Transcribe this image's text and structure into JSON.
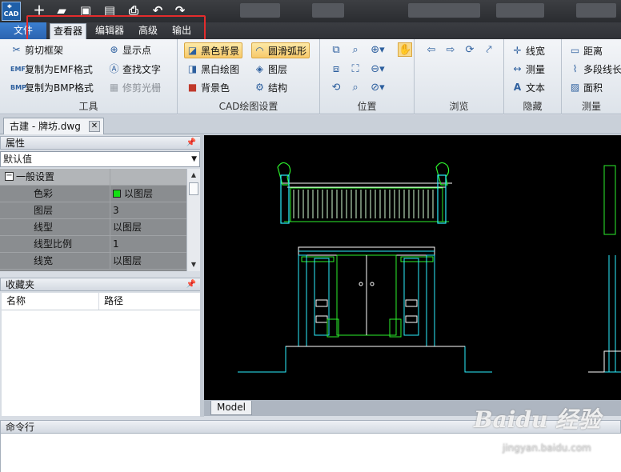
{
  "app": {
    "logo_text": "CAD"
  },
  "quick_access": [
    "new-icon",
    "open-icon",
    "save-icon",
    "save-as-icon",
    "print-icon",
    "undo-icon",
    "redo-icon"
  ],
  "ribbon_tabs": {
    "file": "文件",
    "tabs": [
      {
        "label": "查看器",
        "active": true
      },
      {
        "label": "编辑器",
        "active": false
      },
      {
        "label": "高级",
        "active": false
      },
      {
        "label": "输出",
        "active": false
      }
    ]
  },
  "ribbon": {
    "tools": {
      "label": "工具",
      "buttons": [
        "剪切框架",
        "复制为EMF格式",
        "复制为BMP格式",
        "显示点",
        "查找文字",
        "修剪光栅"
      ]
    },
    "cad_settings": {
      "label": "CAD绘图设置",
      "buttons": [
        "黑色背景",
        "黑白绘图",
        "背景色",
        "圆滑弧形",
        "图层",
        "结构"
      ]
    },
    "position": {
      "label": "位置"
    },
    "browse": {
      "label": "浏览"
    },
    "hide": {
      "label": "隐藏",
      "buttons": [
        "线宽",
        "测量",
        "文本"
      ]
    },
    "measure": {
      "label": "测量",
      "buttons": [
        "距离",
        "多段线长",
        "面积"
      ]
    }
  },
  "document": {
    "tab_label": "古建 - 牌坊.dwg"
  },
  "properties": {
    "title": "属性",
    "selector_value": "默认值",
    "category": "一般设置",
    "rows": [
      {
        "name": "色彩",
        "value": "以图层",
        "color": "#12e012"
      },
      {
        "name": "图层",
        "value": "3"
      },
      {
        "name": "线型",
        "value": "以图层"
      },
      {
        "name": "线型比例",
        "value": "1"
      },
      {
        "name": "线宽",
        "value": "以图层"
      }
    ]
  },
  "favorites": {
    "title": "收藏夹",
    "columns": [
      "名称",
      "路径"
    ]
  },
  "layout_tabs": [
    "Model"
  ],
  "command_line": {
    "title": "命令行"
  },
  "watermark": {
    "line1": "Baidu 经验",
    "line2": "jingyan.baidu.com"
  },
  "colors": {
    "accent_blue": "#2b63b0",
    "highlight_red": "#e32c2c",
    "cad_cyan": "#20e0f0",
    "cad_green": "#2cf02c",
    "cad_white": "#ffffff",
    "cad_background": "#000000"
  }
}
